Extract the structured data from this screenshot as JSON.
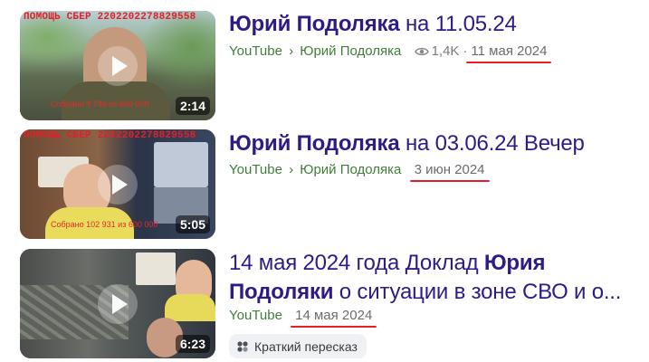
{
  "results": [
    {
      "title_bold": "Юрий Подоляка",
      "title_rest": " на 11.05.24",
      "source": "YouTube",
      "separator": "›",
      "channel": "Юрий Подоляка",
      "views": "1,4K",
      "views_sep": "·",
      "date": "11 мая 2024",
      "duration": "2:14",
      "thumb_promo": "ПОМОЩЬ СБЕР 2202202278829558",
      "thumb_collected": "Собрано 8 749 из 600 000"
    },
    {
      "title_bold": "Юрий Подоляка",
      "title_rest": " на 03.06.24 Вечер",
      "source": "YouTube",
      "separator": "›",
      "channel": "Юрий Подоляка",
      "date": "3 июн 2024",
      "duration": "5:05",
      "thumb_promo": "ПОМОЩЬ СБЕР 2202202278829558",
      "thumb_collected": "Собрано 102 931 из 600 000"
    },
    {
      "title_line1_plain": "14 мая 2024 года Доклад ",
      "title_line1_bold": "Юрия",
      "title_line2_bold": "Подоляки",
      "title_line2_plain": " о ситуации в зоне СВО и о...",
      "source": "YouTube",
      "date": "14 мая 2024",
      "duration": "6:23",
      "chip_label": "Краткий пересказ"
    }
  ],
  "colors": {
    "title": "#2f1a86",
    "source_green": "#3f7e3a",
    "underline_red": "#e3202a",
    "promo_red": "#e3202a"
  },
  "icons": [
    "play-icon",
    "eye-icon",
    "summary-icon"
  ]
}
